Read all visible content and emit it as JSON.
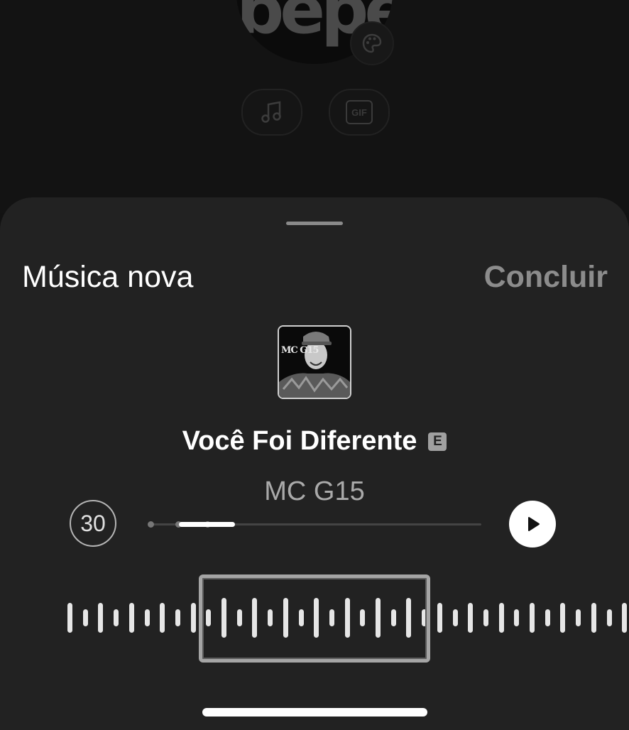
{
  "background": {
    "avatar_text": "bepe",
    "icons": [
      "palette-icon",
      "music-note-icon",
      "gif-icon"
    ],
    "gif_label": "GIF"
  },
  "sheet": {
    "title": "Música nova",
    "done_label": "Concluir",
    "cover_label": "MC G15",
    "song_title": "Você Foi Diferente",
    "explicit_badge": "E",
    "artist": "MC G15",
    "clip_duration": "30",
    "progress_fraction": 0.17,
    "play_icon": "play-icon"
  },
  "colors": {
    "sheet_bg": "#222222",
    "done_disabled": "#8c8c8c",
    "waveform": "#e6e6e6"
  }
}
